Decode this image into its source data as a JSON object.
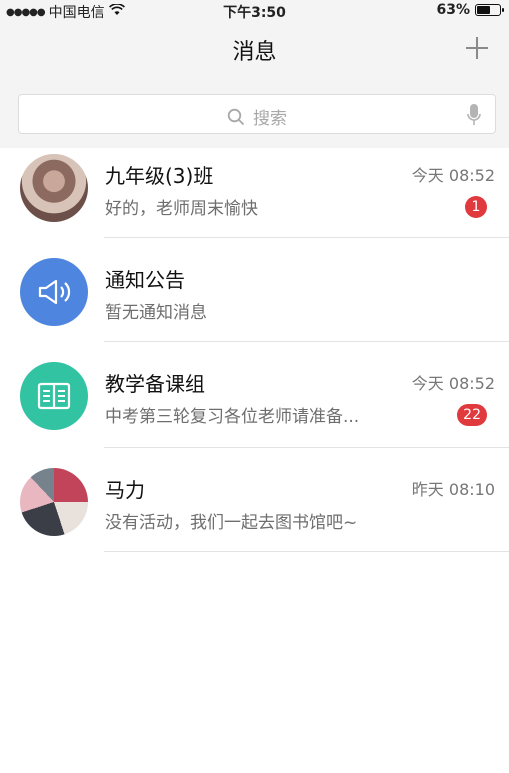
{
  "status_bar": {
    "signal_dots": "●●●●●",
    "carrier": "中国电信",
    "wifi_icon": "wifi-icon",
    "time": "下午3:50",
    "battery_percent": "63%",
    "battery_level": 0.63
  },
  "nav": {
    "title": "消息",
    "add_icon": "plus-icon"
  },
  "search": {
    "placeholder": "搜索",
    "search_icon": "search-icon",
    "mic_icon": "mic-icon"
  },
  "conversations": [
    {
      "title": "九年级(3)班",
      "preview": "好的，老师周末愉快",
      "time": "今天 08:52",
      "badge": "1",
      "avatar": "class-photo-avatar"
    },
    {
      "title": "通知公告",
      "preview": "暂无通知消息",
      "time": "",
      "badge": "",
      "avatar": "megaphone-icon"
    },
    {
      "title": "教学备课组",
      "preview": "中考第三轮复习各位老师请准备...",
      "time": "今天 08:52",
      "badge": "22",
      "avatar": "book-icon"
    },
    {
      "title": "马力",
      "preview": "没有活动，我们一起去图书馆吧~",
      "time": "昨天 08:10",
      "badge": "",
      "avatar": "user-photo-avatar"
    }
  ],
  "colors": {
    "badge": "#e0393e",
    "notice_avatar": "#4e86df",
    "group_avatar": "#31c3a2",
    "bar_background": "#f4f4f4"
  }
}
